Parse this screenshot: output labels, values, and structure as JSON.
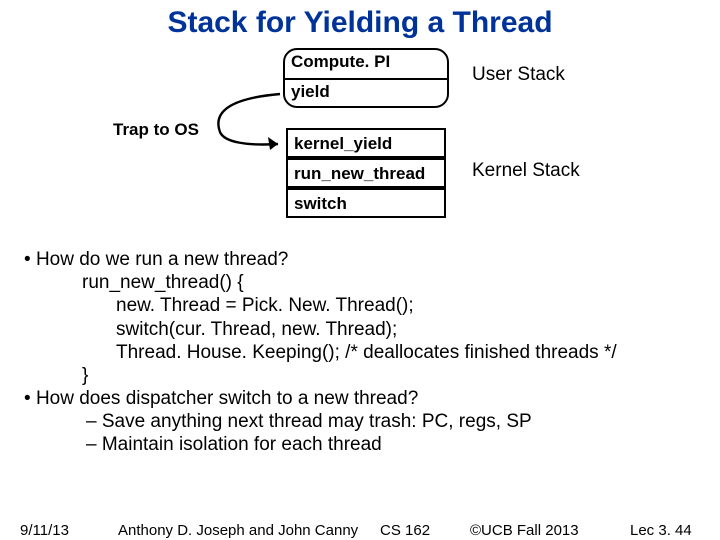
{
  "title": "Stack for Yielding a Thread",
  "diagram": {
    "box1": "Compute. PI",
    "box2": "yield",
    "box3": "kernel_yield",
    "box4": "run_new_thread",
    "box5": "switch",
    "label_user": "User Stack",
    "label_kernel": "Kernel Stack",
    "trap": "Trap to OS"
  },
  "body": {
    "b1": "How do we run a new thread?",
    "c1": "run_new_thread() {",
    "c2": "new. Thread = Pick. New. Thread();",
    "c3": "switch(cur. Thread, new. Thread);",
    "c4": "Thread. House. Keeping(); /* deallocates finished threads */",
    "c5": "}",
    "b2": "How does dispatcher switch to a new thread?",
    "d1": "– Save anything next thread may trash: PC, regs, SP",
    "d2": "– Maintain isolation for each thread"
  },
  "footer": {
    "date": "9/11/13",
    "authors": "Anthony D. Joseph and John Canny",
    "course": "CS 162",
    "copyright": "©UCB Fall 2013",
    "page": "Lec 3. 44"
  }
}
